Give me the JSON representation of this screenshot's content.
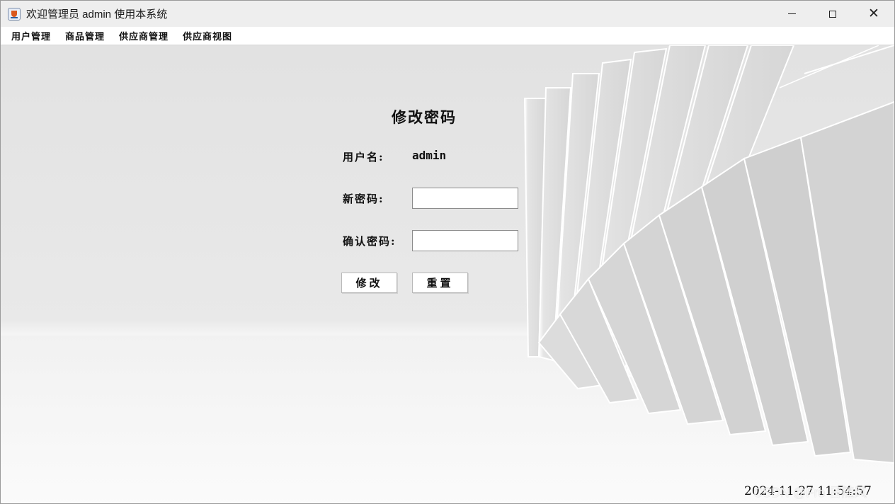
{
  "window": {
    "title": "欢迎管理员 admin 使用本系统",
    "icon": "java-cup-icon",
    "controls": {
      "minimize": "minimize-icon",
      "maximize": "maximize-icon",
      "close": "✕"
    }
  },
  "menu": {
    "items": [
      {
        "label": "用户管理"
      },
      {
        "label": "商品管理"
      },
      {
        "label": "供应商管理"
      },
      {
        "label": "供应商视图"
      }
    ]
  },
  "form": {
    "title": "修改密码",
    "username_label": "用户名:",
    "username_value": "admin",
    "new_password_label": "新密码:",
    "new_password_value": "",
    "confirm_password_label": "确认密码:",
    "confirm_password_value": "",
    "modify_button": "修改",
    "reset_button": "重置"
  },
  "status": {
    "datetime": "2024-11-27 11:54:57",
    "watermark": "CSDN @Fro 日随风"
  },
  "colors": {
    "background": "#e6e6e6",
    "text": "#111111",
    "field_border": "#8c8c8c"
  }
}
